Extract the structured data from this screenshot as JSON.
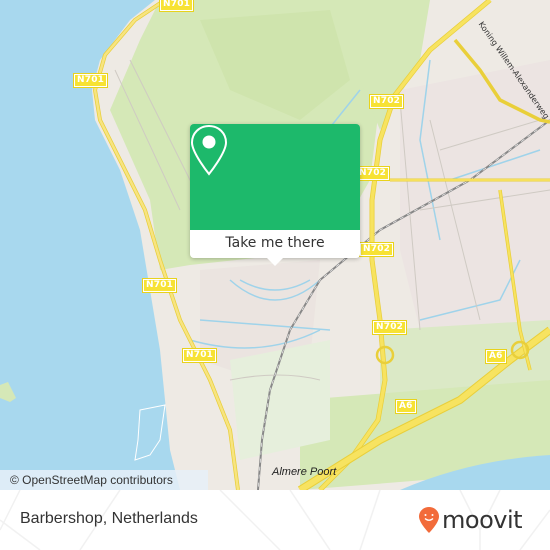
{
  "map": {
    "roads": [
      {
        "label": "N701",
        "id": "n701-top"
      },
      {
        "label": "N701",
        "id": "n701-west"
      },
      {
        "label": "N701",
        "id": "n701-mid"
      },
      {
        "label": "N701",
        "id": "n701-south"
      },
      {
        "label": "N702",
        "id": "n702-north"
      },
      {
        "label": "N702",
        "id": "n702-a"
      },
      {
        "label": "N702",
        "id": "n702-b"
      },
      {
        "label": "N702",
        "id": "n702-east"
      },
      {
        "label": "A6",
        "id": "a6-east"
      },
      {
        "label": "A6",
        "id": "a6-south"
      }
    ],
    "street_label": "Koning Willem-Alexanderweg",
    "place_label": "Almere Poort",
    "attribution": "© OpenStreetMap contributors",
    "colors": {
      "water": "#a8d8ee",
      "park": "#d5e8b7",
      "residential": "#ece6e2",
      "road": "#f7e234",
      "accent": "#1db96b"
    }
  },
  "popup": {
    "button_label": "Take me there",
    "icon": "map-pin-icon"
  },
  "footer": {
    "place_name": "Barbershop, Netherlands",
    "brand": "moovit",
    "brand_color": "#f26b3a"
  }
}
